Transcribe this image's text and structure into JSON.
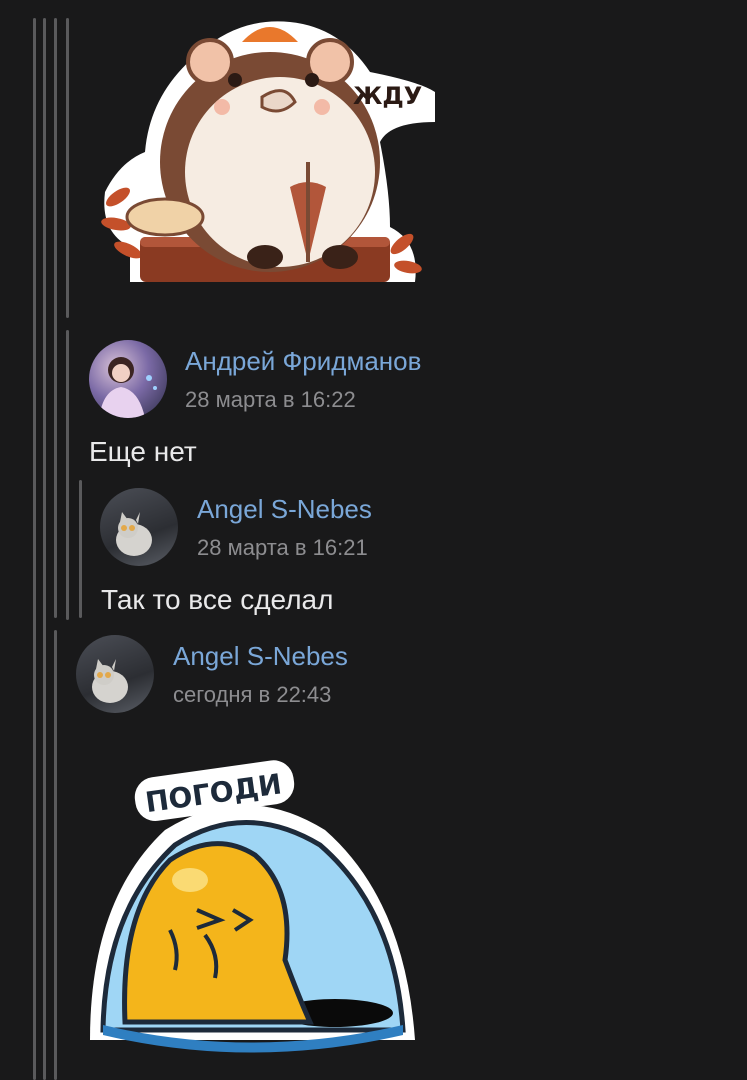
{
  "sticker_top": {
    "caption": "ЖДУ"
  },
  "comments": [
    {
      "author": "Андрей Фридманов",
      "date": "28 марта в 16:22",
      "text": "Еще нет"
    },
    {
      "author": "Angel S-Nebes",
      "date": "28 марта в 16:21",
      "text": "Так то все сделал"
    },
    {
      "author": "Angel S-Nebes",
      "date": "сегодня в 22:43"
    }
  ],
  "sticker_bottom": {
    "caption": "ПОГОДИ"
  },
  "colors": {
    "background": "#19191a",
    "author_link": "#7aa7d8",
    "thread_line": "#5a5a5c"
  }
}
